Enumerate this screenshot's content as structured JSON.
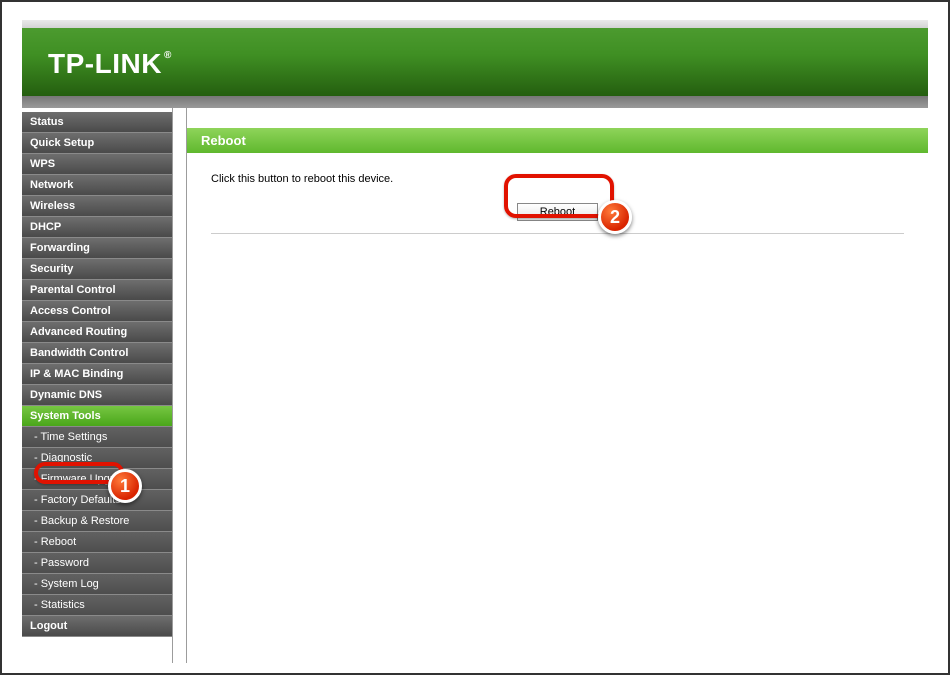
{
  "brand": "TP-LINK",
  "brand_reg": "®",
  "nav": [
    {
      "label": "Status",
      "type": "top"
    },
    {
      "label": "Quick Setup",
      "type": "top"
    },
    {
      "label": "WPS",
      "type": "top"
    },
    {
      "label": "Network",
      "type": "top"
    },
    {
      "label": "Wireless",
      "type": "top"
    },
    {
      "label": "DHCP",
      "type": "top"
    },
    {
      "label": "Forwarding",
      "type": "top"
    },
    {
      "label": "Security",
      "type": "top"
    },
    {
      "label": "Parental Control",
      "type": "top"
    },
    {
      "label": "Access Control",
      "type": "top"
    },
    {
      "label": "Advanced Routing",
      "type": "top"
    },
    {
      "label": "Bandwidth Control",
      "type": "top"
    },
    {
      "label": "IP & MAC Binding",
      "type": "top"
    },
    {
      "label": "Dynamic DNS",
      "type": "top"
    },
    {
      "label": "System Tools",
      "type": "top",
      "active": true
    },
    {
      "label": "- Time Settings",
      "type": "sub"
    },
    {
      "label": "- Diagnostic",
      "type": "sub"
    },
    {
      "label": "- Firmware Upgrade",
      "type": "sub"
    },
    {
      "label": "- Factory Defaults",
      "type": "sub"
    },
    {
      "label": "- Backup & Restore",
      "type": "sub"
    },
    {
      "label": "- Reboot",
      "type": "sub"
    },
    {
      "label": "- Password",
      "type": "sub"
    },
    {
      "label": "- System Log",
      "type": "sub"
    },
    {
      "label": "- Statistics",
      "type": "sub"
    },
    {
      "label": "Logout",
      "type": "top"
    }
  ],
  "page": {
    "title": "Reboot",
    "instruction": "Click this button to reboot this device.",
    "button_label": "Reboot"
  },
  "annotations": {
    "badge1": "1",
    "badge2": "2"
  }
}
